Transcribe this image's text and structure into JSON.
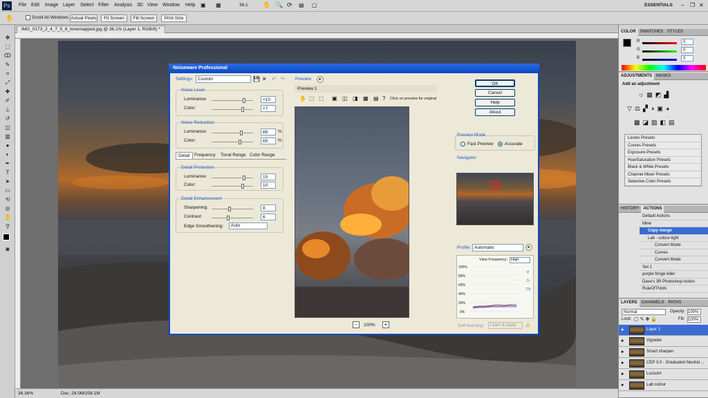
{
  "app": {
    "name": "Ps"
  },
  "menu": [
    "File",
    "Edit",
    "Image",
    "Layer",
    "Select",
    "Filter",
    "Analysis",
    "3D",
    "View",
    "Window",
    "Help"
  ],
  "zoom_menu": "36.1",
  "workspace": "ESSENTIALS",
  "options": {
    "scroll_all": "Scroll All Windows",
    "actual_pixels": "Actual Pixels",
    "fit_screen": "Fit Screen",
    "fill_screen": "Fill Screen",
    "print_size": "Print Size"
  },
  "document": {
    "tab": "IMG_0173_2_4_7_5_6_tonemapped.jpg @ 36.1% (Layer 1, RGB/8) *"
  },
  "status": {
    "zoom": "36.36%",
    "doc": "Doc: 29.0M/208.1M"
  },
  "dialog": {
    "title": "Noiseware Professional",
    "settings_label": "Settings:",
    "settings_value": "Custom",
    "noise_level": {
      "title": "Noise Level",
      "lum_label": "Luminance:",
      "lum_value": "+10",
      "color_label": "Color:",
      "color_value": "+7"
    },
    "noise_reduction": {
      "title": "Noise Reduction",
      "lum_label": "Luminance:",
      "lum_value": "68",
      "color_label": "Color:",
      "color_value": "65",
      "unit": "%"
    },
    "tabs": [
      "Detail",
      "Frequency",
      "Tonal Range",
      "Color Range"
    ],
    "detail_protection": {
      "title": "Detail Protection",
      "lum_label": "Luminance:",
      "lum_value": "15",
      "color_label": "Color:",
      "color_value": "10"
    },
    "detail_enhancement": {
      "title": "Detail Enhancement",
      "sharp_label": "Sharpening:",
      "sharp_value": "8",
      "contrast_label": "Contrast:",
      "contrast_value": "6",
      "edge_label": "Edge Smoothening:",
      "edge_value": "Auto"
    },
    "preview_label": "Preview",
    "preview_tab": "Preview 1",
    "preview_hint": "Click on preview for original",
    "preview_zoom": "100%",
    "buttons": {
      "ok": "OK",
      "cancel": "Cancel",
      "help": "Help",
      "about": "About"
    },
    "preview_mode": {
      "title": "Preview Mode",
      "fast": "Fast Preview",
      "accurate": "Accurate"
    },
    "navigator": "Navigator",
    "profile": {
      "label": "Profile:",
      "value": "Automatic",
      "view_freq_label": "View Frequency:",
      "view_freq_value": "High",
      "y_ticks": [
        "100%",
        "80%",
        "60%",
        "40%",
        "20%",
        "0%"
      ],
      "legend": [
        "Y",
        "Cr",
        "Cb"
      ],
      "self_learning": "Self-learning:",
      "learn_apply": "Learn & Apply"
    }
  },
  "panels": {
    "color_tabs": [
      "COLOR",
      "SWATCHES",
      "STYLES"
    ],
    "rgb": [
      {
        "ch": "R",
        "val": "0"
      },
      {
        "ch": "G",
        "val": "0"
      },
      {
        "ch": "B",
        "val": "0"
      }
    ],
    "adj_tabs": [
      "ADJUSTMENTS",
      "MASKS"
    ],
    "add_adjustment": "Add an adjustment",
    "presets": [
      "Levels Presets",
      "Curves Presets",
      "Exposure Presets",
      "Hue/Saturation Presets",
      "Black & White Presets",
      "Channel Mixer Presets",
      "Selective Color Presets"
    ],
    "action_tabs": [
      "HISTORY",
      "ACTIONS"
    ],
    "actions": [
      "Default Actions",
      "Mine",
      "Copy merge",
      "Lab - colour-light",
      "Convert Mode",
      "Curves",
      "Convert Mode",
      "Set 1",
      "purple fringe killer",
      "Dave's 3R Photoshop Action",
      "RuleOfThirds"
    ],
    "layer_tabs": [
      "LAYERS",
      "CHANNELS",
      "PATHS"
    ],
    "blend": "Normal",
    "opacity_label": "Opacity:",
    "opacity": "100%",
    "lock_label": "Lock:",
    "fill_label": "Fill:",
    "fill": "100%",
    "layers": [
      "Layer 1",
      "Vignette",
      "Smart sharpen",
      "CEP 3.0 - Graduated Neutral ...",
      "LucisArt",
      "Lab colour"
    ]
  }
}
